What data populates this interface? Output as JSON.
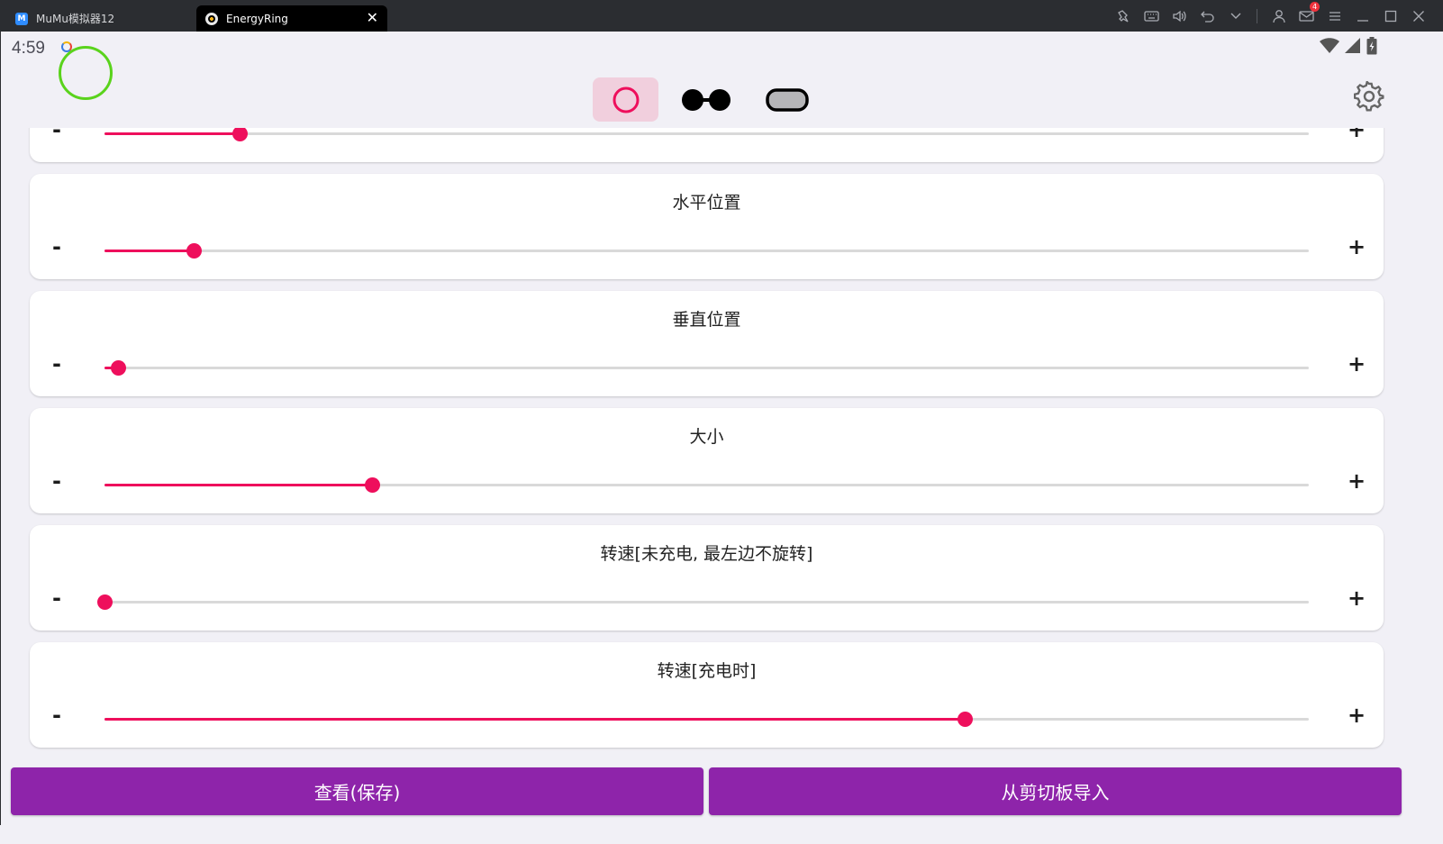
{
  "window": {
    "tabs": [
      {
        "label": "MuMu模拟器12",
        "icon": "mumu-app-icon",
        "active": false
      },
      {
        "label": "EnergyRing",
        "icon": "energyring-app-icon",
        "active": true
      }
    ],
    "notification_count": "4",
    "toolbar_icons": [
      "pin-icon",
      "keyboard-icon",
      "volume-icon",
      "undo-icon",
      "chevron-down-icon",
      "user-icon",
      "mail-icon",
      "menu-icon",
      "minimize-icon",
      "maximize-icon",
      "close-icon"
    ]
  },
  "status_bar": {
    "time": "4:59",
    "icons": [
      "wifi-icon",
      "signal-icon",
      "battery-icon"
    ]
  },
  "shape_selector": {
    "options": [
      "ring-shape",
      "dual-ring-shape",
      "pill-shape"
    ],
    "selected": "ring-shape"
  },
  "cards": [
    {
      "title": "",
      "minus": "-",
      "plus": "+",
      "value": 0.112
    },
    {
      "title": "水平位置",
      "minus": "-",
      "plus": "+",
      "value": 0.074
    },
    {
      "title": "垂直位置",
      "minus": "-",
      "plus": "+",
      "value": 0.011
    },
    {
      "title": "大小",
      "minus": "-",
      "plus": "+",
      "value": 0.222
    },
    {
      "title": "转速[未充电, 最左边不旋转]",
      "minus": "-",
      "plus": "+",
      "value": 0.0
    },
    {
      "title": "转速[充电时]",
      "minus": "-",
      "plus": "+",
      "value": 0.714
    }
  ],
  "buttons": {
    "view_save": "查看(保存)",
    "import_clipboard": "从剪切板导入"
  },
  "colors": {
    "accent": "#ee0f5c",
    "button": "#8e24aa",
    "ring": "#5ad31c"
  }
}
